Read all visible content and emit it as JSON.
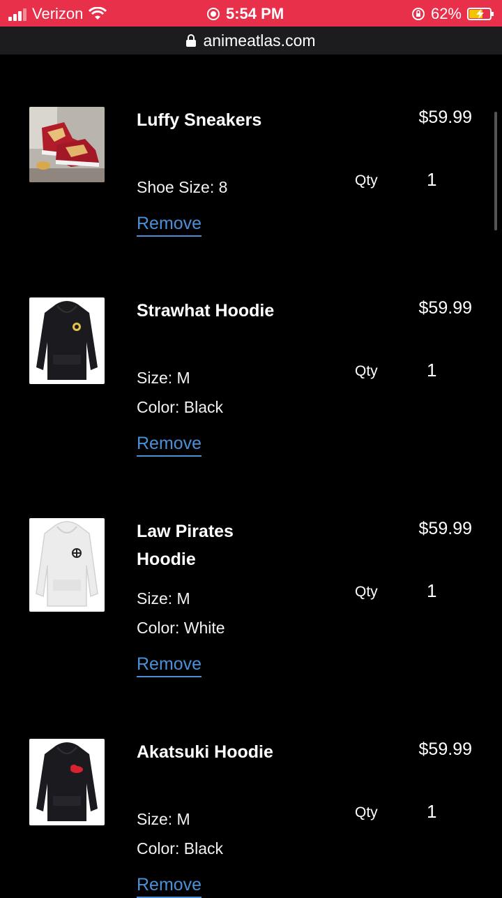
{
  "status_bar": {
    "carrier": "Verizon",
    "time": "5:54 PM",
    "battery": "62%"
  },
  "browser": {
    "url": "animeatlas.com"
  },
  "cart": {
    "qty_label": "Qty",
    "remove_label": "Remove",
    "items": [
      {
        "name": "Luffy Sneakers",
        "options": [
          "Shoe Size: 8"
        ],
        "price": "$59.99",
        "qty": "1",
        "image": "red-sneakers-image"
      },
      {
        "name": "Strawhat Hoodie",
        "options": [
          "Size: M",
          "Color: Black"
        ],
        "price": "$59.99",
        "qty": "1",
        "image": "black-hoodie-image"
      },
      {
        "name": "Law Pirates Hoodie",
        "options": [
          "Size: M",
          "Color: White"
        ],
        "price": "$59.99",
        "qty": "1",
        "image": "white-hoodie-image"
      },
      {
        "name": "Akatsuki Hoodie",
        "options": [
          "Size: M",
          "Color: Black"
        ],
        "price": "$59.99",
        "qty": "1",
        "image": "black-hoodie-cloud-image"
      }
    ]
  },
  "colors": {
    "status_bar": "#e8304a",
    "link": "#4a90d9",
    "background": "#000000"
  }
}
